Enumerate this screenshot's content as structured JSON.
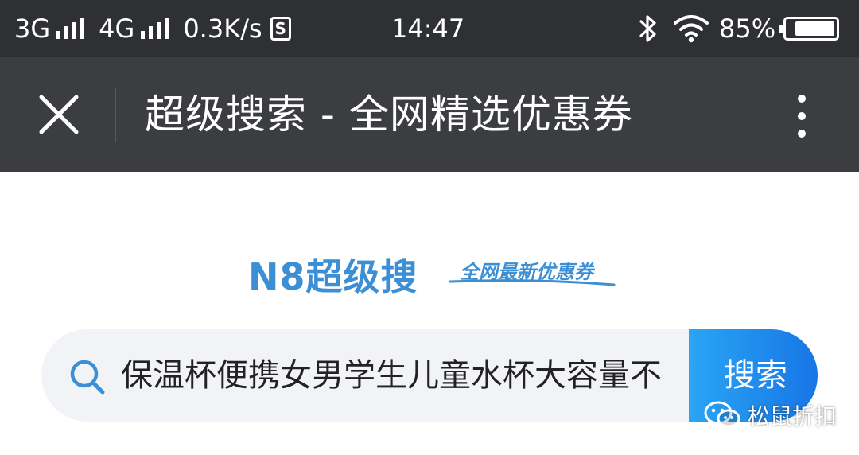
{
  "status_bar": {
    "network_1": "3G",
    "network_2": "4G",
    "speed": "0.3K/s",
    "sd_badge": "S",
    "time": "14:47",
    "battery": "85%",
    "battery_level": 0.85,
    "icons": [
      "signal-bars-icon",
      "sd-card-icon",
      "bluetooth-icon",
      "wifi-icon",
      "battery-icon"
    ]
  },
  "nav_bar": {
    "title": "超级搜索 - 全网精选优惠券",
    "icons": [
      "close-icon",
      "more-vertical-icon"
    ]
  },
  "logo": {
    "mark": "N8超级搜",
    "slogan": "全网最新优惠券"
  },
  "search": {
    "query": "保温杯便携女男学生儿童水杯大容量不",
    "button_label": "搜索",
    "icon": "search-icon"
  },
  "watermark": {
    "text": "松鼠折扣",
    "icon": "wechat-icon"
  },
  "colors": {
    "status_bg": "#2e3034",
    "nav_bg": "#3b3d41",
    "brand_blue": "#3c8fd4",
    "button_start": "#2aa5f5",
    "button_end": "#1776e6",
    "search_bg": "#f2f3f7"
  }
}
